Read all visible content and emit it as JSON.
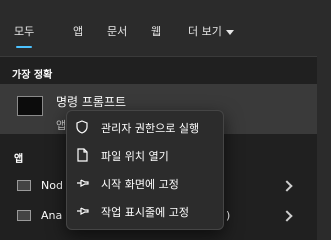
{
  "tabs": [
    {
      "label": "모두"
    },
    {
      "label": "앱"
    },
    {
      "label": "문서"
    },
    {
      "label": "웹"
    },
    {
      "label": "더 보기"
    }
  ],
  "sections": {
    "best_match": "가장 정확",
    "apps": "앱"
  },
  "best_match": {
    "title": "명령 프롬프트",
    "subtitle": "앱"
  },
  "apps": [
    {
      "label": "Nod"
    },
    {
      "label": "Ana"
    }
  ],
  "apps_overflow": ")",
  "context_menu": {
    "items": [
      {
        "label": "관리자 권한으로 실행",
        "icon": "shield-icon"
      },
      {
        "label": "파일 위치 열기",
        "icon": "file-icon"
      },
      {
        "label": "시작 화면에 고정",
        "icon": "pin-icon"
      },
      {
        "label": "작업 표시줄에 고정",
        "icon": "pin-icon"
      }
    ]
  },
  "colors": {
    "accent": "#4cc2ff",
    "background": "#202020",
    "menu": "#2c2c2c"
  }
}
